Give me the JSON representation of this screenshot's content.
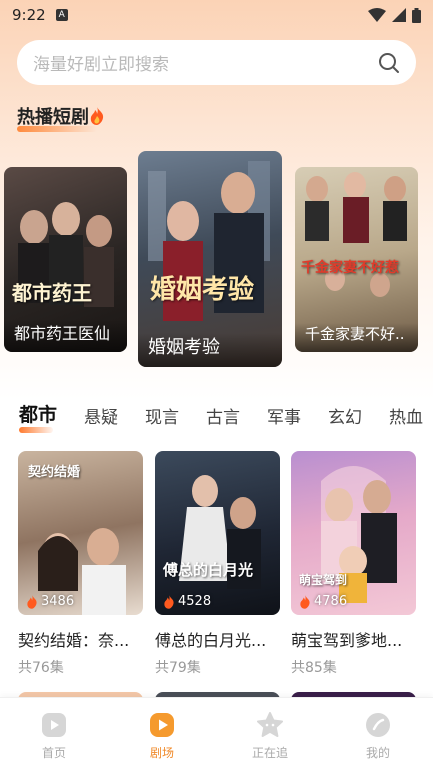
{
  "status_bar": {
    "time": "9:22",
    "notif_icon_letter": "A"
  },
  "search": {
    "placeholder": "海量好剧立即搜索"
  },
  "hot_section": {
    "title": "热播短剧",
    "items": [
      {
        "title": "都市药王医仙",
        "art_text": "都市药王"
      },
      {
        "title": "婚姻考验",
        "art_text": "婚姻考验"
      },
      {
        "title": "千金家妻不好..",
        "art_text": "千金家妻不好惹"
      }
    ]
  },
  "genre_tabs": [
    "都市",
    "悬疑",
    "现言",
    "古言",
    "军事",
    "玄幻",
    "热血"
  ],
  "active_tab": "都市",
  "cards": [
    {
      "title": "契约结婚：奈...",
      "heat": "3486",
      "episodes": "共76集",
      "art_text": "契约结婚"
    },
    {
      "title": "傅总的白月光...",
      "heat": "4528",
      "episodes": "共79集",
      "art_text": "傅总的白月光"
    },
    {
      "title": "萌宝驾到爹地...",
      "heat": "4786",
      "episodes": "共85集",
      "art_text": "萌宝驾到"
    }
  ],
  "bottom_nav": [
    {
      "label": "首页",
      "icon": "play-icon"
    },
    {
      "label": "剧场",
      "icon": "theater-icon"
    },
    {
      "label": "正在追",
      "icon": "star-icon"
    },
    {
      "label": "我的",
      "icon": "profile-icon"
    }
  ],
  "colors": {
    "accent": "#f08a2a",
    "inactive": "#aaaaaa"
  }
}
